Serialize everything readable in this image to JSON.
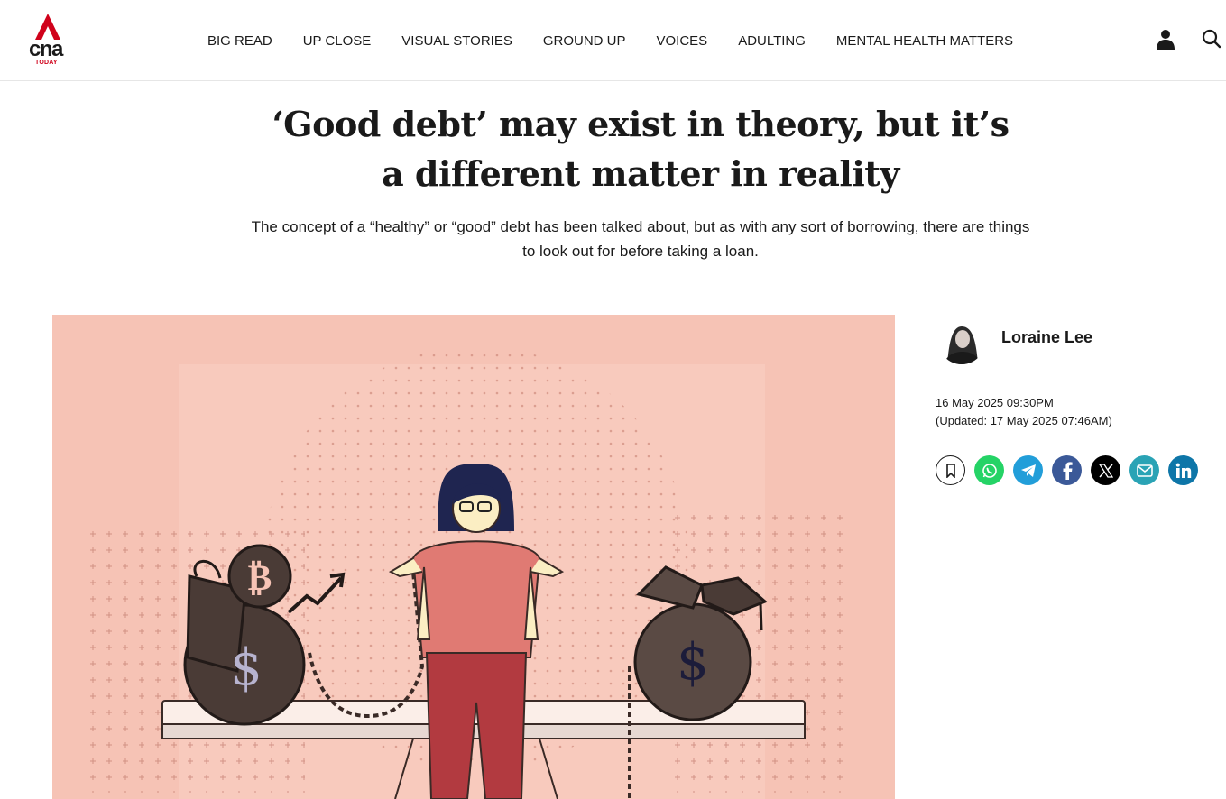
{
  "brand": {
    "name": "cna",
    "sub": "TODAY",
    "color": "#d0021b"
  },
  "nav": {
    "items": [
      {
        "label": "BIG READ"
      },
      {
        "label": "UP CLOSE"
      },
      {
        "label": "VISUAL STORIES"
      },
      {
        "label": "GROUND UP"
      },
      {
        "label": "VOICES"
      },
      {
        "label": "ADULTING"
      },
      {
        "label": "MENTAL HEALTH MATTERS"
      }
    ],
    "icons": [
      "user-icon",
      "search-icon"
    ]
  },
  "article": {
    "headline": "‘Good debt’ may exist in theory, but it’s a different matter in reality",
    "subhead": "The concept of a “healthy” or “good” debt has been talked about, but as with any sort of borrowing, there are things to look out for before taking a loan.",
    "hero_image": "illustration-woman-balancing-debt-weights",
    "hero_image_symbols": [
      "₿",
      "$",
      "$"
    ]
  },
  "sidebar": {
    "author": "Loraine Lee",
    "published": "16 May 2025 09:30PM",
    "updated": "(Updated: 17 May 2025 07:46AM)",
    "share": [
      {
        "name": "bookmark",
        "icon": "bookmark-icon",
        "color": "#ffffff"
      },
      {
        "name": "whatsapp",
        "icon": "whatsapp-icon",
        "color": "#25d366"
      },
      {
        "name": "telegram",
        "icon": "telegram-icon",
        "color": "#229ed9"
      },
      {
        "name": "facebook",
        "icon": "facebook-icon",
        "color": "#3b5998"
      },
      {
        "name": "x",
        "icon": "x-icon",
        "color": "#000000"
      },
      {
        "name": "email",
        "icon": "email-icon",
        "color": "#2aa3b5"
      },
      {
        "name": "linkedin",
        "icon": "linkedin-icon",
        "color": "#0e76a8"
      }
    ]
  }
}
